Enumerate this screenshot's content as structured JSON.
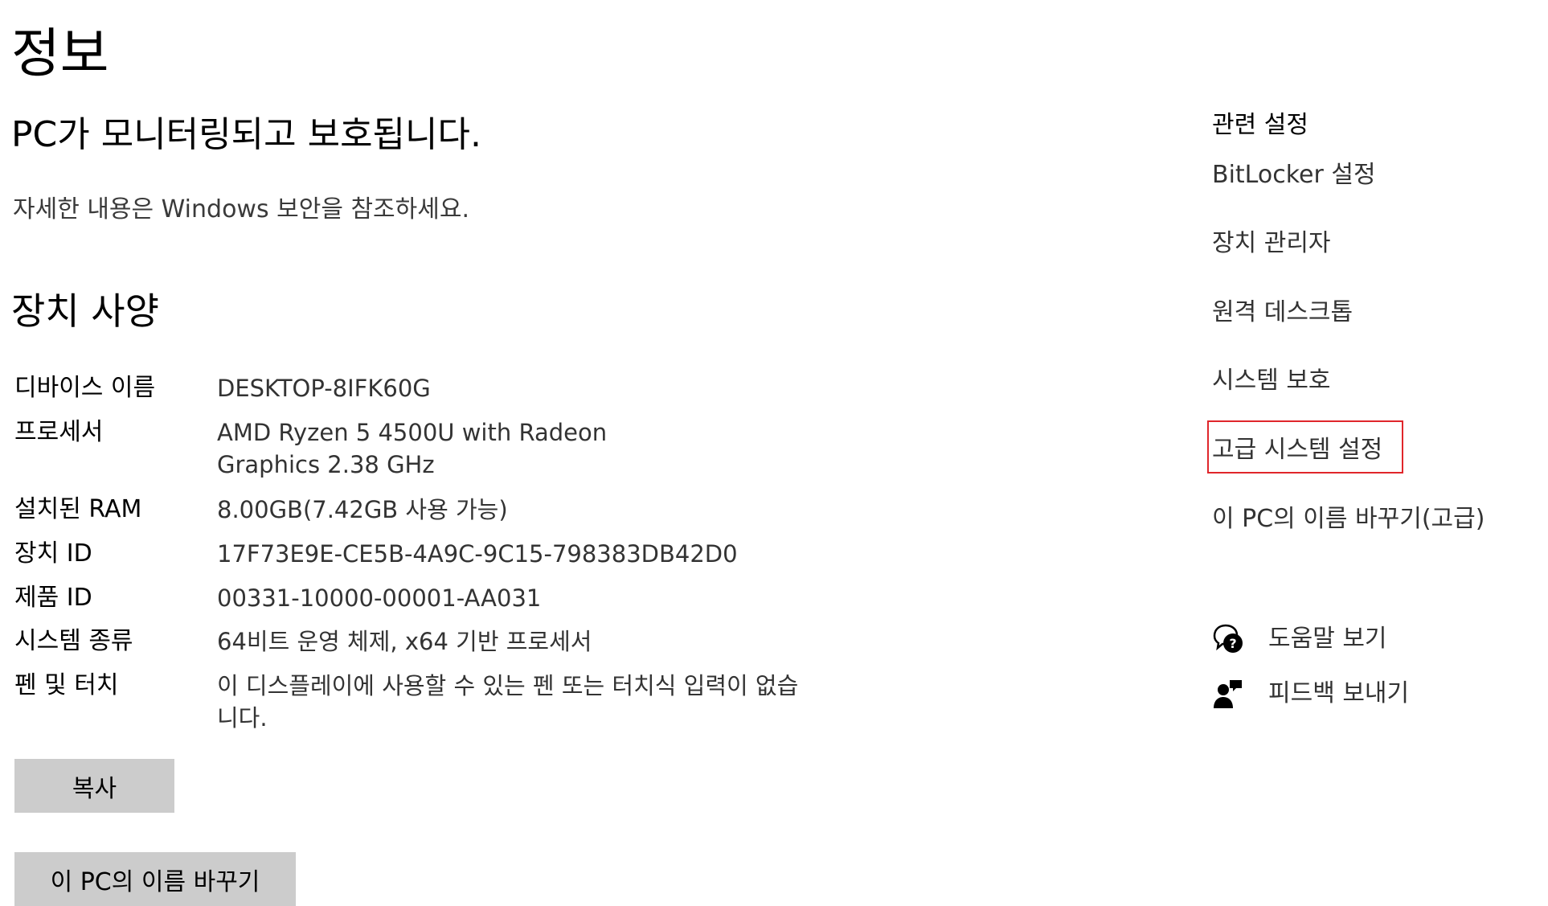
{
  "page": {
    "title": "정보"
  },
  "status": {
    "heading": "PC가 모니터링되고 보호됩니다.",
    "detail_link": "자세한 내용은 Windows 보안을 참조하세요."
  },
  "device_specs": {
    "heading": "장치 사양",
    "rows": [
      {
        "label": "디바이스 이름",
        "value": "DESKTOP-8IFK60G"
      },
      {
        "label": "프로세서",
        "value": "AMD Ryzen 5 4500U with Radeon Graphics 2.38 GHz"
      },
      {
        "label": "설치된 RAM",
        "value": "8.00GB(7.42GB 사용 가능)"
      },
      {
        "label": "장치 ID",
        "value": "17F73E9E-CE5B-4A9C-9C15-798383DB42D0"
      },
      {
        "label": "제품 ID",
        "value": "00331-10000-00001-AA031"
      },
      {
        "label": "시스템 종류",
        "value": "64비트 운영 체제, x64 기반 프로세서"
      },
      {
        "label": "펜 및 터치",
        "value": "이 디스플레이에 사용할 수 있는 펜 또는 터치식 입력이 없습니다."
      }
    ]
  },
  "buttons": {
    "copy": "복사",
    "rename": "이 PC의 이름 바꾸기"
  },
  "related_settings": {
    "heading": "관련 설정",
    "links": [
      "BitLocker 설정",
      "장치 관리자",
      "원격 데스크톱",
      "시스템 보호",
      "고급 시스템 설정",
      "이 PC의 이름 바꾸기(고급)"
    ]
  },
  "support": {
    "help": {
      "label": "도움말 보기",
      "icon": "help-chat-icon"
    },
    "feedback": {
      "label": "피드백 보내기",
      "icon": "feedback-icon"
    }
  },
  "colors": {
    "highlight_border": "#e0262b",
    "button_bg": "#cccccc"
  }
}
